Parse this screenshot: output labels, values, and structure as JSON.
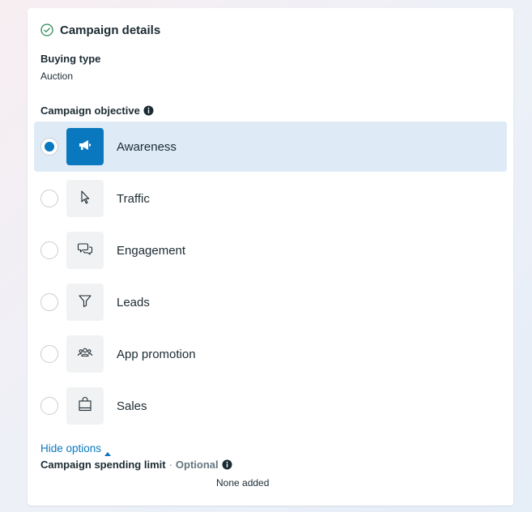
{
  "header": {
    "title": "Campaign details"
  },
  "buying_type": {
    "label": "Buying type",
    "value": "Auction"
  },
  "objective": {
    "label": "Campaign objective",
    "options": [
      {
        "label": "Awareness",
        "icon": "megaphone-icon",
        "selected": true
      },
      {
        "label": "Traffic",
        "icon": "cursor-icon",
        "selected": false
      },
      {
        "label": "Engagement",
        "icon": "chat-bubbles-icon",
        "selected": false
      },
      {
        "label": "Leads",
        "icon": "funnel-icon",
        "selected": false
      },
      {
        "label": "App promotion",
        "icon": "people-icon",
        "selected": false
      },
      {
        "label": "Sales",
        "icon": "shopping-bag-icon",
        "selected": false
      }
    ]
  },
  "hide_options": {
    "label": "Hide options"
  },
  "spending_limit": {
    "label": "Campaign spending limit",
    "separator": "·",
    "optional": "Optional",
    "value": "None added"
  },
  "colors": {
    "accent": "#0a78be",
    "selected_bg": "#deebf7",
    "tile_bg": "#f1f2f3",
    "text": "#1c2b33",
    "muted": "#65767f"
  }
}
